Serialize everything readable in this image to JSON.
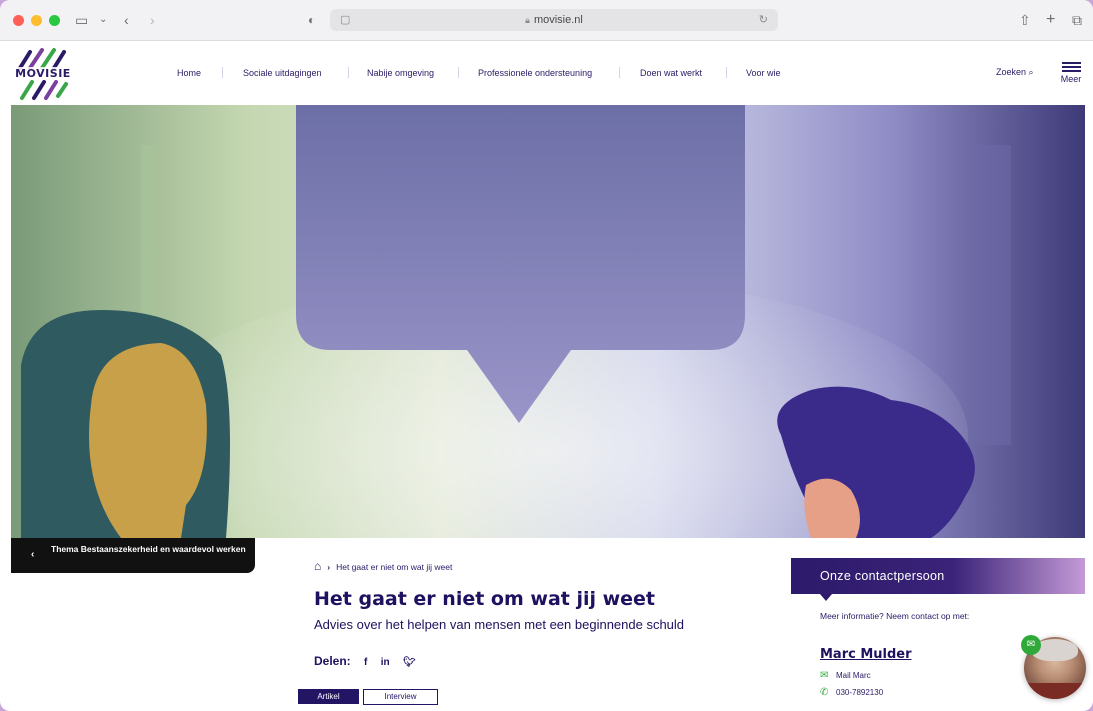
{
  "browser": {
    "url": "movisie.nl"
  },
  "logo": {
    "text": "MOVISIE"
  },
  "nav": {
    "items": [
      "Home",
      "Sociale uitdagingen",
      "Nabije omgeving",
      "Professionele ondersteuning",
      "Doen wat werkt",
      "Voor wie"
    ],
    "search_label": "Zoeken",
    "menu_label": "Meer"
  },
  "theme_bar": {
    "label": "Thema Bestaanszekerheid en waardevol werken"
  },
  "breadcrumb": {
    "current": "Het gaat er niet om wat jij weet"
  },
  "article": {
    "title": "Het gaat er niet om wat jij weet",
    "subtitle": "Advies over het helpen van mensen met een beginnende schuld",
    "share_label": "Delen:",
    "share_icons": [
      "f",
      "in",
      "twitter-icon"
    ],
    "tags": [
      "Artikel",
      "Interview"
    ]
  },
  "contact": {
    "heading": "Onze contactpersoon",
    "intro": "Meer informatie? Neem contact op met:",
    "name": "Marc Mulder",
    "mail_label": "Mail Marc",
    "phone": "030-7892130"
  },
  "colors": {
    "brand": "#2b1a66",
    "accent_green": "#2faa3a"
  }
}
